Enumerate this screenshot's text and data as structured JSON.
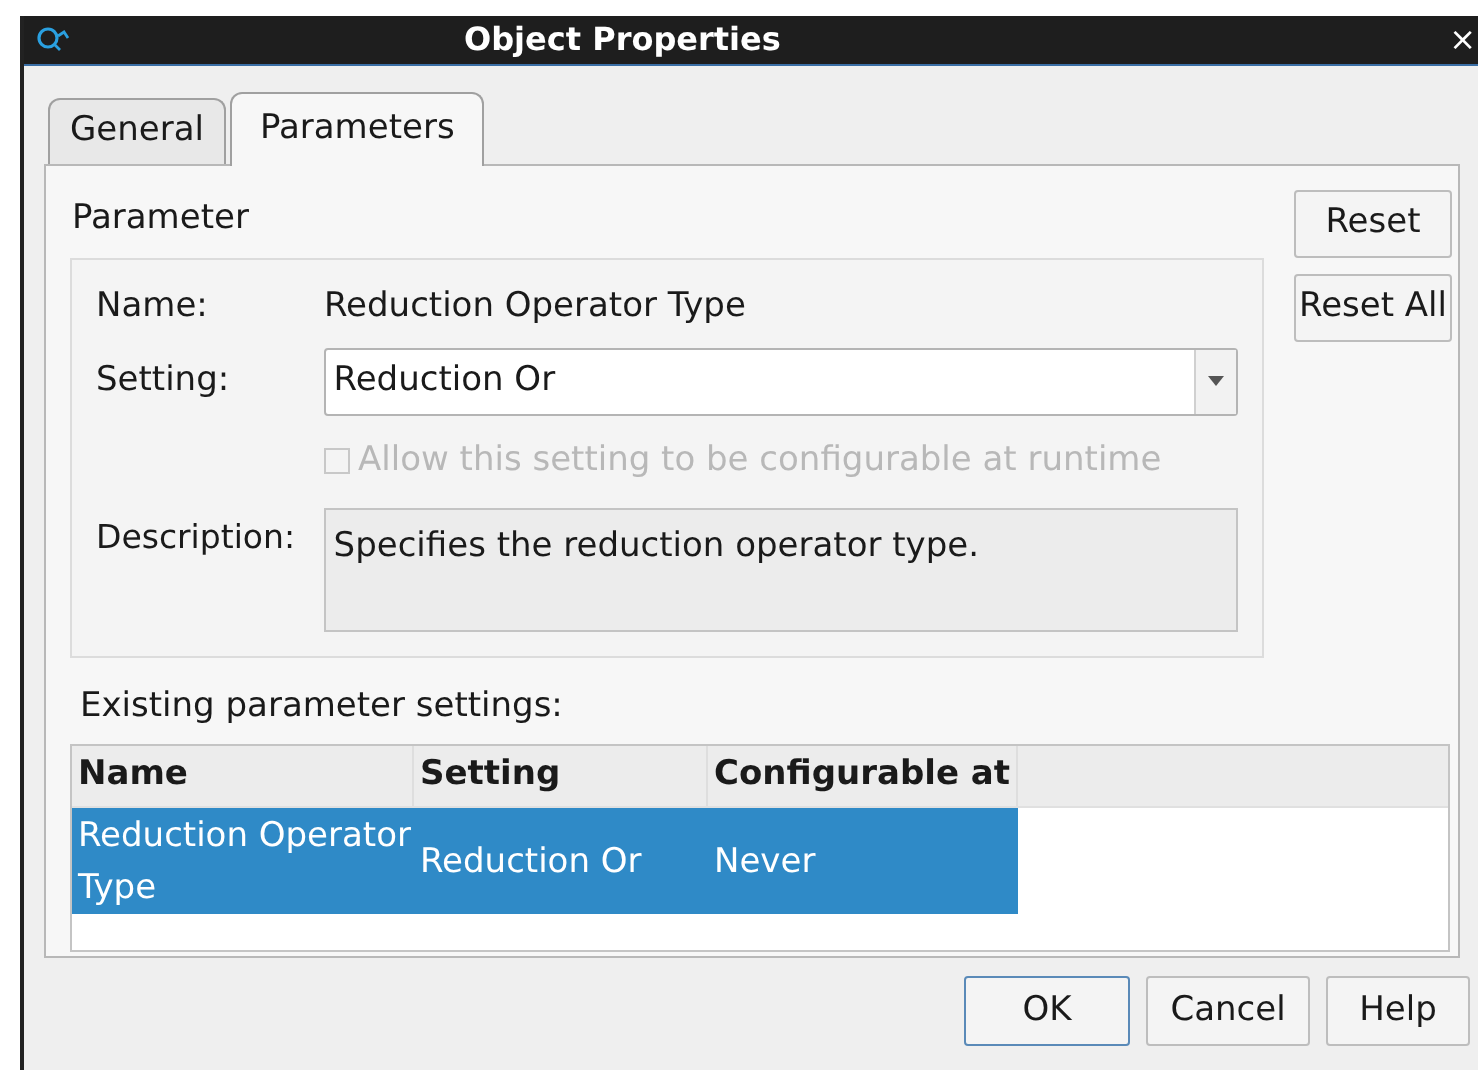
{
  "window": {
    "title": "Object Properties",
    "close": "×"
  },
  "tabs": [
    {
      "label": "General",
      "selected": false
    },
    {
      "label": "Parameters",
      "selected": true
    }
  ],
  "parameter": {
    "heading": "Parameter",
    "name_label": "Name:",
    "name_value": "Reduction Operator Type",
    "setting_label": "Setting:",
    "setting_value": "Reduction Or",
    "runtime_checkbox": {
      "label": "Allow this setting to be configurable at runtime",
      "checked": false,
      "disabled": true
    },
    "description_label": "Description:",
    "description": "Specifies the reduction operator type."
  },
  "side_buttons": [
    "Reset",
    "Reset All"
  ],
  "existing": {
    "heading": "Existing parameter settings:",
    "columns": [
      "Name",
      "Setting",
      "Configurable at"
    ],
    "rows": [
      {
        "cells": [
          "Reduction Operator Type",
          "Reduction Or",
          "Never"
        ],
        "selected": true
      }
    ]
  },
  "buttons": [
    {
      "label": "OK",
      "default": true
    },
    {
      "label": "Cancel",
      "default": false
    },
    {
      "label": "Help",
      "default": false
    }
  ]
}
